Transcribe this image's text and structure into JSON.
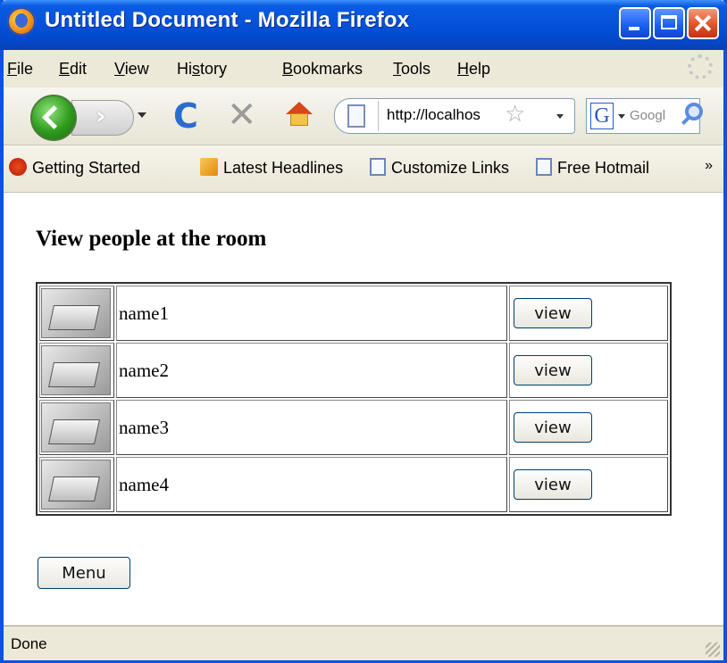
{
  "window": {
    "title": "Untitled Document - Mozilla Firefox"
  },
  "menu": {
    "items": [
      {
        "pre": "",
        "key": "F",
        "post": "ile"
      },
      {
        "pre": "",
        "key": "E",
        "post": "dit"
      },
      {
        "pre": "",
        "key": "V",
        "post": "iew"
      },
      {
        "pre": "Hi",
        "key": "s",
        "post": "tory"
      },
      {
        "pre": "",
        "key": "B",
        "post": "ookmarks"
      },
      {
        "pre": "",
        "key": "T",
        "post": "ools"
      },
      {
        "pre": "",
        "key": "H",
        "post": "elp"
      }
    ]
  },
  "nav": {
    "url": "http://localhos",
    "search_engine_icon": "G",
    "search_placeholder": "Googl"
  },
  "bookmarks": {
    "items": [
      "Getting Started",
      "Latest Headlines",
      "Customize Links",
      "Free Hotmail"
    ],
    "more": "»"
  },
  "page": {
    "title": "View people at the room",
    "people": [
      {
        "name": "name1",
        "button": "view"
      },
      {
        "name": "name2",
        "button": "view"
      },
      {
        "name": "name3",
        "button": "view"
      },
      {
        "name": "name4",
        "button": "view"
      }
    ],
    "menu_button": "Menu"
  },
  "status": {
    "text": "Done"
  }
}
